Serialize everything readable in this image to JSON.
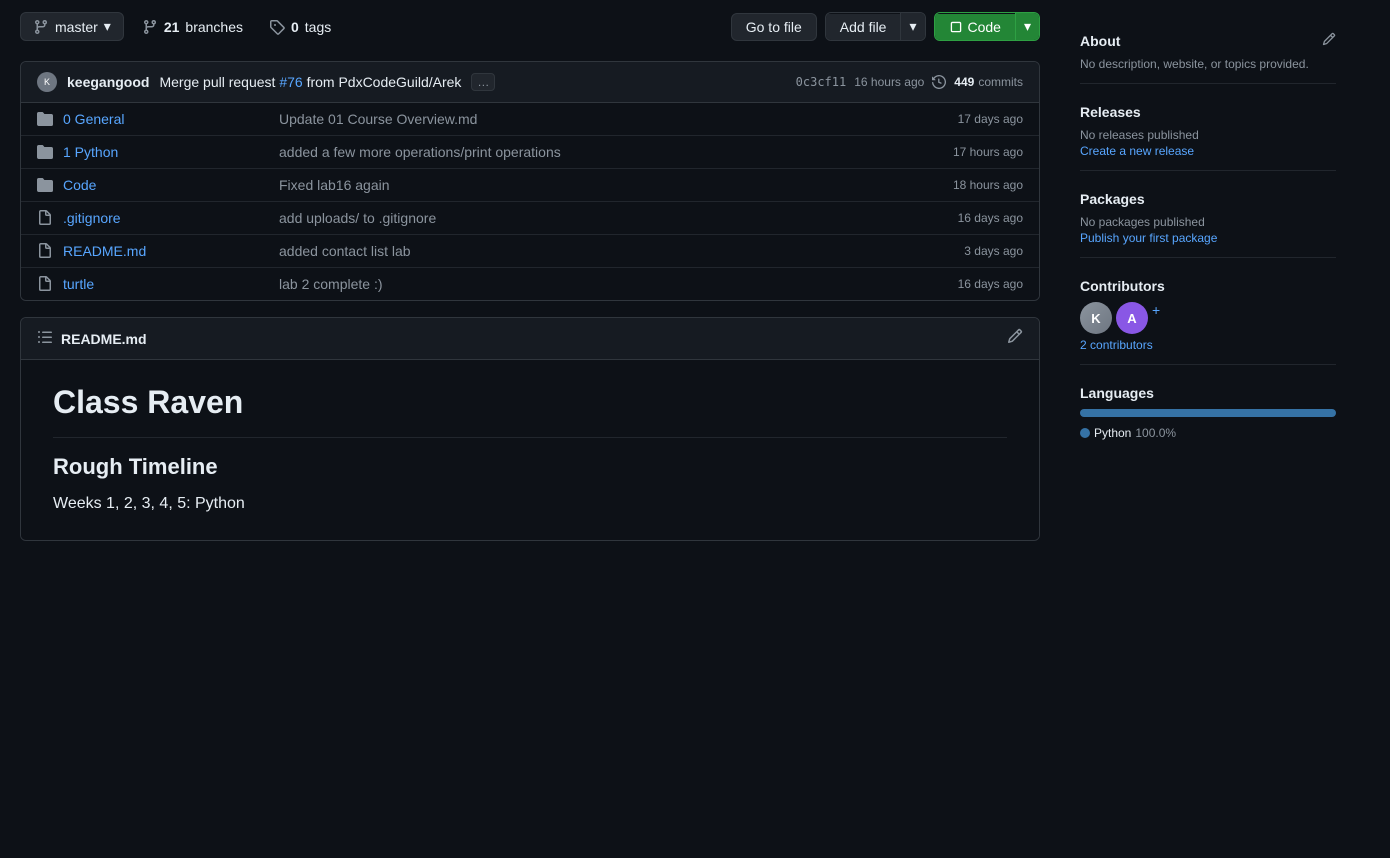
{
  "toolbar": {
    "branch_label": "master",
    "branch_icon": "⑂",
    "branches_count": "21",
    "branches_label": "branches",
    "tags_count": "0",
    "tags_label": "tags",
    "go_to_file": "Go to file",
    "add_file": "Add file",
    "add_file_dropdown": "▾",
    "code_label": "Code",
    "code_dropdown": "▾"
  },
  "commit_row": {
    "author": "keegangood",
    "message_prefix": "Merge pull request",
    "pr_link": "#76",
    "message_suffix": "from PdxCodeGuild/Arek",
    "hash": "0c3cf11",
    "time_ago": "16 hours ago",
    "commits_count": "449",
    "commits_label": "commits"
  },
  "files": [
    {
      "icon": "folder",
      "name": "0 General",
      "commit_msg": "Update 01 Course Overview.md",
      "time": "17 days ago"
    },
    {
      "icon": "folder",
      "name": "1 Python",
      "commit_msg": "added a few more operations/print operations",
      "time": "17 hours ago"
    },
    {
      "icon": "folder",
      "name": "Code",
      "commit_msg": "Fixed lab16 again",
      "time": "18 hours ago"
    },
    {
      "icon": "file",
      "name": ".gitignore",
      "commit_msg": "add uploads/ to .gitignore",
      "time": "16 days ago"
    },
    {
      "icon": "file",
      "name": "README.md",
      "commit_msg": "added contact list lab",
      "time": "3 days ago"
    },
    {
      "icon": "file",
      "name": "turtle",
      "commit_msg": "lab 2 complete :)",
      "time": "16 days ago"
    }
  ],
  "readme": {
    "header_icon": "☰",
    "title": "README.md",
    "edit_icon": "✏",
    "h1": "Class Raven",
    "h2": "Rough Timeline",
    "paragraph": "Weeks 1, 2, 3, 4, 5: Python"
  },
  "sidebar": {
    "about_title": "About",
    "no_description": "No description, website, or topics provided.",
    "releases_title": "Releases",
    "no_releases": "No releases published",
    "create_release": "Create a new release",
    "packages_title": "Packages",
    "no_packages": "No packages published",
    "publish_package": "Publish your first package",
    "contributors_title": "Contributors",
    "contributors_count_text": "2",
    "contributors_link": "2 contributors",
    "plus_label": "+",
    "languages_title": "Languages",
    "languages": [
      {
        "name": "Python",
        "percent": "100.0",
        "color": "#3572A5"
      }
    ]
  }
}
